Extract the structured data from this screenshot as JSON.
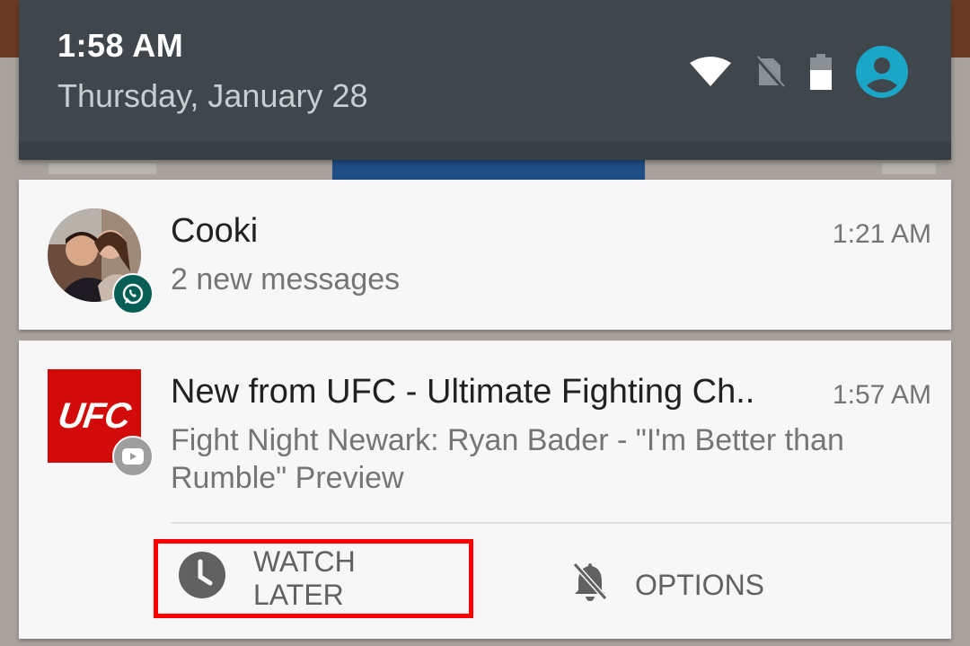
{
  "status_bar": {
    "time": "1:58 AM",
    "date": "Thursday, January 28",
    "icons": [
      "wifi-icon",
      "no-sim-icon",
      "battery-icon",
      "user-account-icon"
    ]
  },
  "notifications": [
    {
      "app": "WhatsApp",
      "app_icon": "whatsapp-icon",
      "title": "Cooki",
      "text": "2 new messages",
      "time": "1:21 AM"
    },
    {
      "app": "YouTube",
      "app_icon": "youtube-icon",
      "logo_text": "UFC",
      "title": "New from UFC - Ultimate Fighting Ch..",
      "text": "Fight Night Newark: Ryan Bader - \"I'm Better than Rumble\" Preview",
      "time": "1:57 AM",
      "actions": [
        {
          "label": "WATCH LATER",
          "icon": "clock-icon"
        },
        {
          "label": "OPTIONS",
          "icon": "notifications-off-icon"
        }
      ]
    }
  ],
  "colors": {
    "header_bg": "#3f474c",
    "card_bg": "#f7f7f7",
    "accent_cyan": "#1aa6c6",
    "whatsapp_green": "#075e54",
    "ufc_red": "#d20a0a",
    "highlight_red": "#ff0000"
  }
}
